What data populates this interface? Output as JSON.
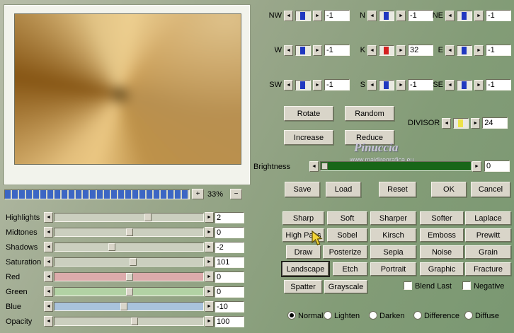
{
  "icons": {
    "arrow_left": "◄",
    "arrow_right": "►",
    "plus_label": "+",
    "minus_label": "−"
  },
  "preview": {
    "zoom_level": "33%"
  },
  "adjust_sliders": [
    {
      "label": "Highlights",
      "value": "2"
    },
    {
      "label": "Midtones",
      "value": "0"
    },
    {
      "label": "Shadows",
      "value": "-2"
    },
    {
      "label": "Saturation",
      "value": "101"
    },
    {
      "label": "Red",
      "value": "0"
    },
    {
      "label": "Green",
      "value": "0"
    },
    {
      "label": "Blue",
      "value": "-10"
    },
    {
      "label": "Opacity",
      "value": "100"
    }
  ],
  "directions": [
    {
      "label": "NW",
      "value": "-1"
    },
    {
      "label": "N",
      "value": "-1"
    },
    {
      "label": "NE",
      "value": "-1"
    },
    {
      "label": "W",
      "value": "-1"
    },
    {
      "label": "K",
      "value": "32"
    },
    {
      "label": "E",
      "value": "-1"
    },
    {
      "label": "SW",
      "value": "-1"
    },
    {
      "label": "S",
      "value": "-1"
    },
    {
      "label": "SE",
      "value": "-1"
    }
  ],
  "divisor": {
    "label": "DIVISOR",
    "value": "24"
  },
  "brightness": {
    "label": "Brightness",
    "value": "0"
  },
  "action_buttons": {
    "rotate": "Rotate",
    "random": "Random",
    "increase": "Increase",
    "reduce": "Reduce",
    "save": "Save",
    "load": "Load",
    "reset": "Reset",
    "ok": "OK",
    "cancel": "Cancel"
  },
  "watermark": {
    "name": "Pinuccia",
    "site": "www.maidiregrafica.eu"
  },
  "filter_buttons": [
    {
      "label": "Sharp"
    },
    {
      "label": "Soft"
    },
    {
      "label": "Sharper"
    },
    {
      "label": "Softer"
    },
    {
      "label": "Laplace"
    },
    {
      "label": "High Pass"
    },
    {
      "label": "Sobel"
    },
    {
      "label": "Kirsch"
    },
    {
      "label": "Emboss"
    },
    {
      "label": "Prewitt"
    },
    {
      "label": "Draw"
    },
    {
      "label": "Posterize"
    },
    {
      "label": "Sepia"
    },
    {
      "label": "Noise"
    },
    {
      "label": "Grain"
    },
    {
      "label": "Landscape",
      "selected": true
    },
    {
      "label": "Etch"
    },
    {
      "label": "Portrait"
    },
    {
      "label": "Graphic"
    },
    {
      "label": "Fracture"
    },
    {
      "label": "Spatter"
    },
    {
      "label": "Grayscale"
    }
  ],
  "checkboxes": [
    {
      "label": "Blend Last",
      "checked": false
    },
    {
      "label": "Negative",
      "checked": false
    }
  ],
  "blend_modes": [
    {
      "label": "Normal",
      "selected": true
    },
    {
      "label": "Lighten",
      "selected": false
    },
    {
      "label": "Darken",
      "selected": false
    },
    {
      "label": "Difference",
      "selected": false
    },
    {
      "label": "Diffuse",
      "selected": false
    }
  ],
  "colors": {
    "thumb_blue": "#2038c0",
    "thumb_red": "#d42020",
    "thumb_yellow": "#ece24a",
    "brightness_track": "#186618",
    "progress_blue": "#3c66c4"
  }
}
